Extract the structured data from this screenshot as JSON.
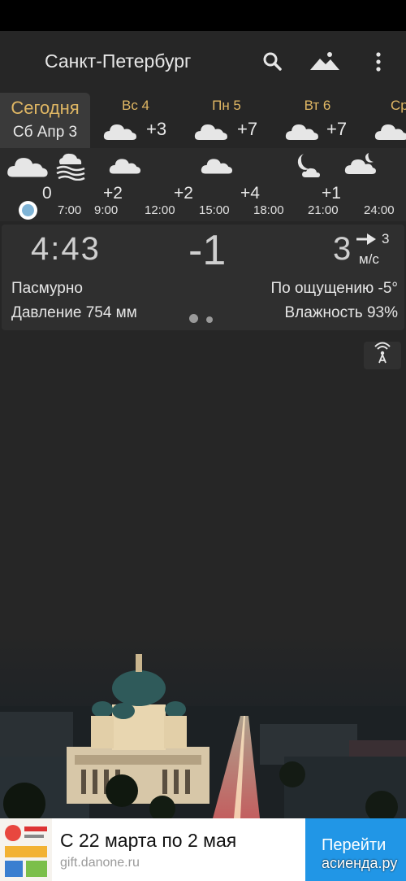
{
  "app": {
    "city": "Санкт-Петербург",
    "icons": {
      "search": "search-icon",
      "scene": "mountain-icon",
      "menu": "more-vert-icon"
    }
  },
  "days": [
    {
      "name": "Сегодня",
      "date": "Сб Апр 3",
      "selected": true
    },
    {
      "name": "Вс 4",
      "temp": "+3",
      "icon": "cloud-icon"
    },
    {
      "name": "Пн 5",
      "temp": "+7",
      "icon": "cloud-icon"
    },
    {
      "name": "Вт 6",
      "temp": "+7",
      "icon": "cloud-icon"
    },
    {
      "name": "Ср",
      "icon": "cloud-icon"
    }
  ],
  "hourly": {
    "icons": [
      "cloud-icon",
      "fog-icon",
      "cloud-icon",
      "cloud-icon",
      "moon-cloud-icon",
      "moon-cloud-icon"
    ],
    "temps": [
      "0",
      "+2",
      "+2",
      "+4",
      "+1"
    ],
    "times": [
      "7:00",
      "9:00",
      "12:00",
      "15:00",
      "18:00",
      "21:00",
      "24:00"
    ]
  },
  "current": {
    "time": "4:43",
    "temp": "-1",
    "wind_speed": "3",
    "wind_gust": "3",
    "wind_unit": "м/с",
    "condition": "Пасмурно",
    "feels_like": "По ощущению -5°",
    "pressure": "Давление 754 мм",
    "humidity": "Влажность 93%",
    "pages": 2,
    "active_page": 1
  },
  "ad": {
    "title": "С 22 марта по 2 мая",
    "domain": "gift.danone.ru",
    "button": "Перейти"
  },
  "watermark": "асиенда.ру",
  "colors": {
    "accent": "#e0b764",
    "background": "#262626",
    "ad_button": "#2196e6",
    "now_dot": "#7fb4d6"
  }
}
